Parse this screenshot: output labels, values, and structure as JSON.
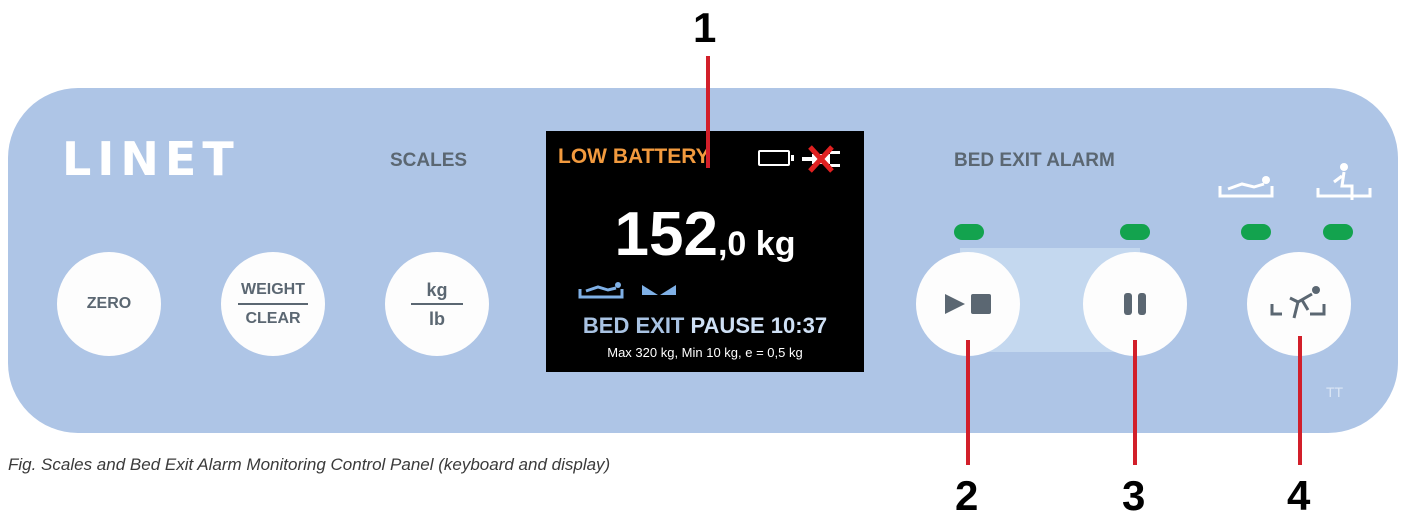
{
  "brand": {
    "logo": "LINET"
  },
  "scales": {
    "label": "SCALES",
    "zero_label": "ZERO",
    "weight_label": "WEIGHT",
    "clear_label": "CLEAR",
    "unit_top": "kg",
    "unit_bottom": "lb"
  },
  "display": {
    "warning": "LOW BATTERY",
    "weight_int": "152",
    "weight_dec": ",0 kg",
    "status_left": "BED EXIT",
    "status_mode": "PAUSE",
    "status_time": "10:37",
    "spec": "Max 320 kg, Min 10 kg, e = 0,5 kg"
  },
  "bed_exit": {
    "label": "BED EXIT ALARM"
  },
  "callouts": {
    "c1": "1",
    "c2": "2",
    "c3": "3",
    "c4": "4"
  },
  "caption": "Fig. Scales and Bed Exit Alarm Monitoring Control Panel (keyboard and display)",
  "watermark": "TT",
  "icons": [
    "battery-icon",
    "plug-crossed-icon",
    "patient-lying-icon",
    "bed-angle-icon",
    "play-stop-icon",
    "pause-icon",
    "patient-exiting-icon",
    "patient-sitting-icon"
  ],
  "colors": {
    "panel": "#aec5e6",
    "led": "#13a34e",
    "warning": "#f29a3e",
    "callout": "#d21f2a"
  }
}
